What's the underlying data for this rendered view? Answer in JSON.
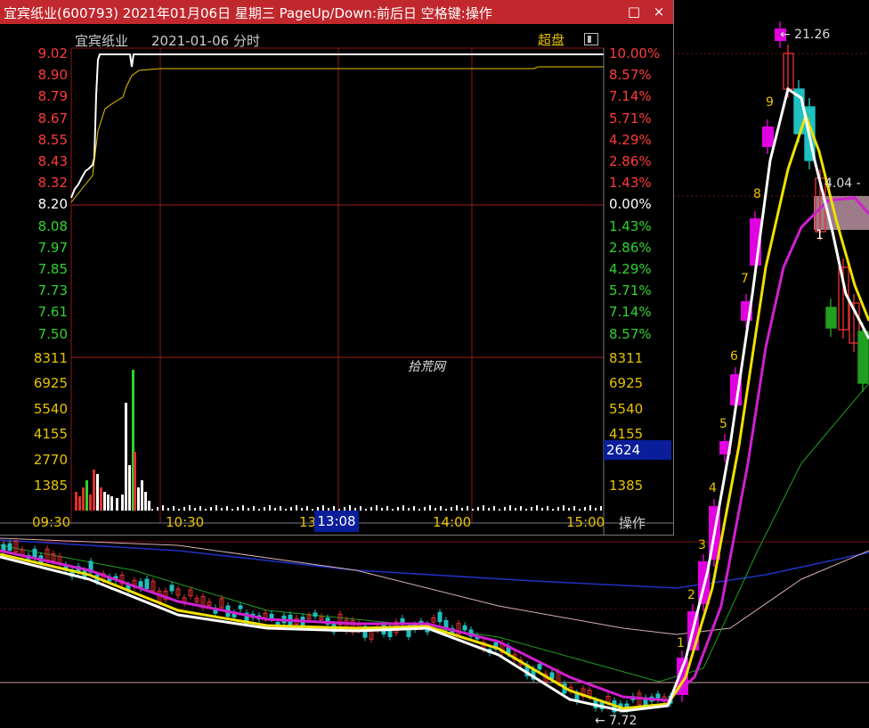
{
  "window": {
    "title": "宜宾纸业(600793) 2021年01月06日 星期三 PageUp/Down:前后日 空格键:操作",
    "restore_icon": "□",
    "close_icon": "×"
  },
  "intraday": {
    "stock_name": "宜宾纸业",
    "date_label": "2021-01-06 分时",
    "mode_label": "超盘",
    "price_ticks": [
      {
        "value": "9.02",
        "color": "#ff3b3b"
      },
      {
        "value": "8.90",
        "color": "#ff3b3b"
      },
      {
        "value": "8.79",
        "color": "#ff3b3b"
      },
      {
        "value": "8.67",
        "color": "#ff3b3b"
      },
      {
        "value": "8.55",
        "color": "#ff3b3b"
      },
      {
        "value": "8.43",
        "color": "#ff3b3b"
      },
      {
        "value": "8.32",
        "color": "#ff3b3b"
      },
      {
        "value": "8.20",
        "color": "#ffffff"
      },
      {
        "value": "8.08",
        "color": "#2fd42f"
      },
      {
        "value": "7.97",
        "color": "#2fd42f"
      },
      {
        "value": "7.85",
        "color": "#2fd42f"
      },
      {
        "value": "7.73",
        "color": "#2fd42f"
      },
      {
        "value": "7.61",
        "color": "#2fd42f"
      },
      {
        "value": "7.50",
        "color": "#2fd42f"
      }
    ],
    "pct_ticks": [
      {
        "value": "10.00%",
        "color": "#ff3b3b"
      },
      {
        "value": "8.57%",
        "color": "#ff3b3b"
      },
      {
        "value": "7.14%",
        "color": "#ff3b3b"
      },
      {
        "value": "5.71%",
        "color": "#ff3b3b"
      },
      {
        "value": "4.29%",
        "color": "#ff3b3b"
      },
      {
        "value": "2.86%",
        "color": "#ff3b3b"
      },
      {
        "value": "1.43%",
        "color": "#ff3b3b"
      },
      {
        "value": "0.00%",
        "color": "#ffffff"
      },
      {
        "value": "1.43%",
        "color": "#2fd42f"
      },
      {
        "value": "2.86%",
        "color": "#2fd42f"
      },
      {
        "value": "4.29%",
        "color": "#2fd42f"
      },
      {
        "value": "5.71%",
        "color": "#2fd42f"
      },
      {
        "value": "7.14%",
        "color": "#2fd42f"
      },
      {
        "value": "8.57%",
        "color": "#2fd42f"
      }
    ],
    "volume_ticks": [
      "8311",
      "6925",
      "5540",
      "4155",
      "2770",
      "1385"
    ],
    "time_ticks": [
      "09:30",
      "10:30",
      "13",
      "14:00",
      "15:00"
    ],
    "crosshair_time": "13:08",
    "crosshair_volume": "2624",
    "op_label": "操作",
    "watermark": "拾荒网",
    "colors": {
      "price_line": "#ffffff",
      "avg_line": "#e8c300",
      "grid": "#8a1a1a",
      "titlebar": "#c0282d"
    }
  },
  "kline": {
    "high_label": "← 21.26",
    "low_label": "← 7.72",
    "mid_label": "4.04 -",
    "count_labels": [
      "1",
      "2",
      "3",
      "4",
      "5",
      "6",
      "7",
      "8",
      "9"
    ],
    "box_label": "1",
    "colors": {
      "up": "#e000e0",
      "down": "#1fc0c0",
      "ma5": "#ffffff",
      "ma10": "#f0e000",
      "ma20": "#d020d0",
      "ma60": "#20a020",
      "ma120": "#2030c0",
      "ma250": "#d8b0b0"
    }
  }
}
